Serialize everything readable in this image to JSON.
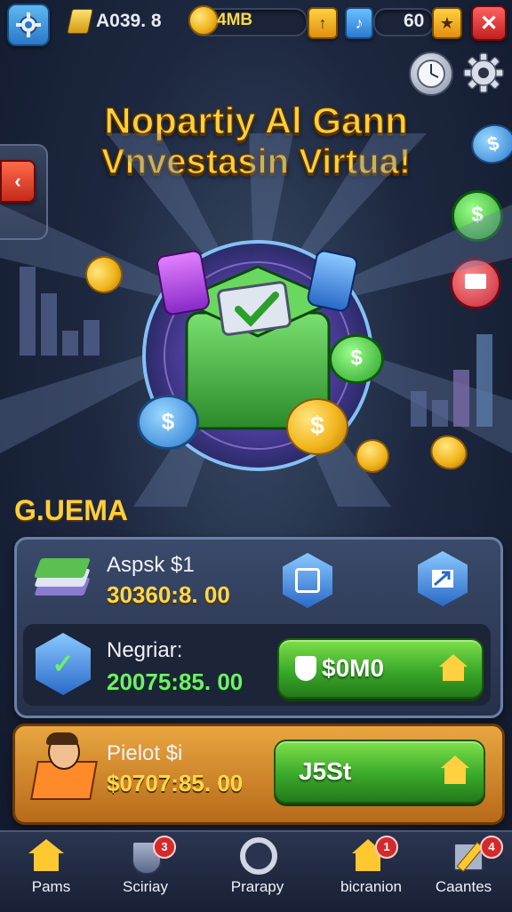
{
  "top_bar": {
    "balance_1": "A039. 8",
    "balance_2": "4MB",
    "count": "60"
  },
  "title": {
    "line1": "Nopartiy Al Gann",
    "line2": "Vnvestasin Virtua!"
  },
  "section_title": "G.UEMA",
  "cards": [
    {
      "label": "Aspsk $1",
      "value": "30360:8. 00"
    },
    {
      "label": "Negriar:",
      "value": "20075:85. 00",
      "button": "$0M0"
    },
    {
      "label": "Pielot $i",
      "value": "$0707:85. 00",
      "button": "J5St"
    }
  ],
  "nav": [
    {
      "label": "Pams",
      "icon": "house-icon"
    },
    {
      "label": "Sciriay",
      "icon": "shield-icon",
      "badge": "3"
    },
    {
      "label": "Prarapy",
      "icon": "ring-icon"
    },
    {
      "label": "bicranion",
      "icon": "house-icon",
      "badge": "1"
    },
    {
      "label": "Caantes",
      "icon": "pencil-icon",
      "badge": "4"
    }
  ],
  "colors": {
    "title_gold": "#ffcf3a",
    "value_yellow": "#ffd84a",
    "value_green": "#6ef06a",
    "button_green": "#3aa92a",
    "close_red": "#d43030"
  }
}
